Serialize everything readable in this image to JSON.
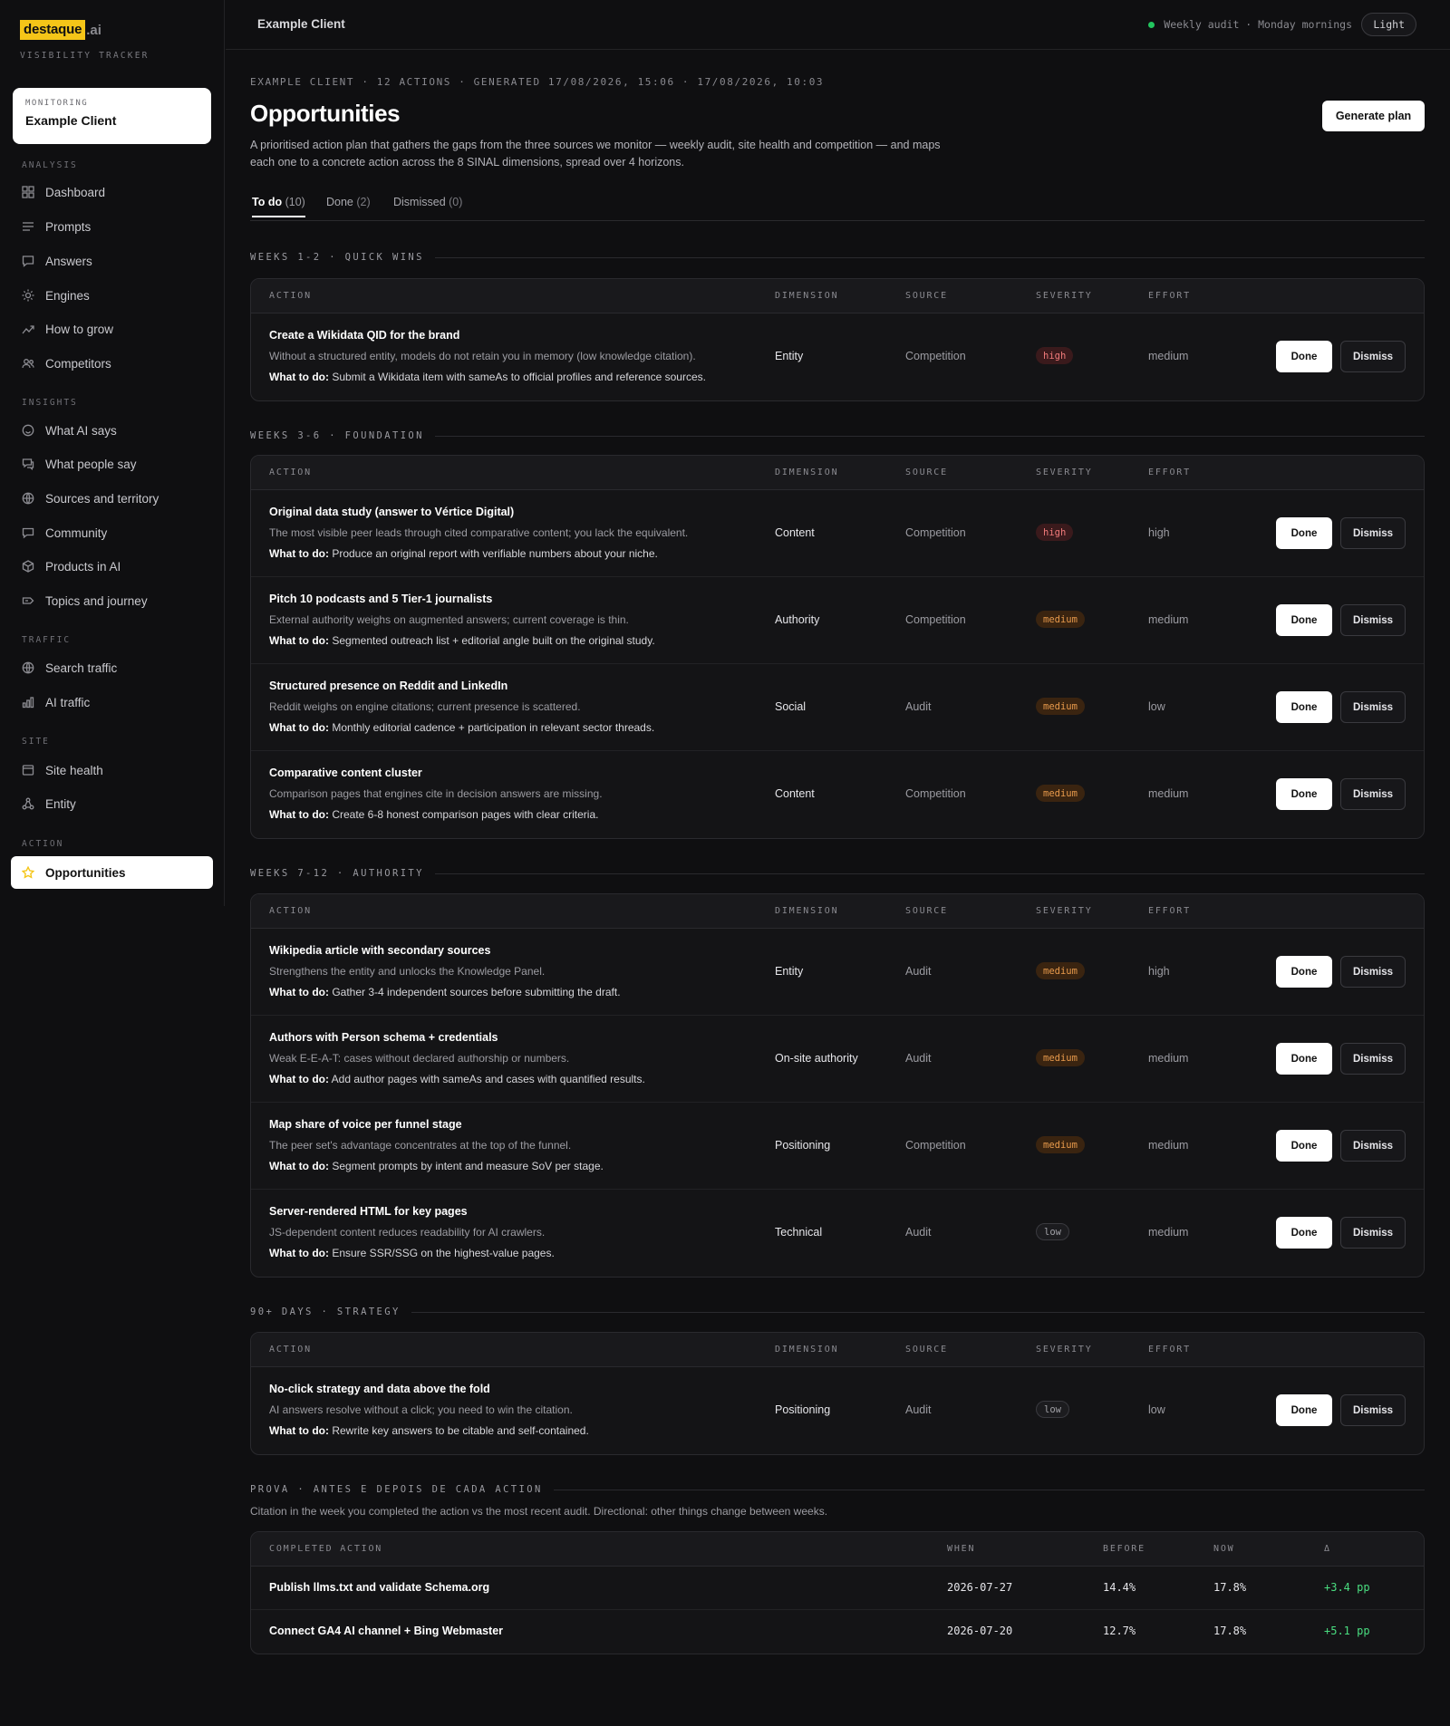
{
  "brand": {
    "logo_main": "destaque",
    "logo_suffix": ".ai",
    "subtitle": "VISIBILITY TRACKER",
    "accent": "#f5c518"
  },
  "monitoring": {
    "label": "MONITORING",
    "client": "Example Client"
  },
  "nav": {
    "sections": [
      {
        "title": "ANALYSIS",
        "items": [
          {
            "label": "Dashboard",
            "icon": "grid-icon"
          },
          {
            "label": "Prompts",
            "icon": "lines-icon"
          },
          {
            "label": "Answers",
            "icon": "chat-icon"
          },
          {
            "label": "Engines",
            "icon": "sun-icon"
          },
          {
            "label": "How to grow",
            "icon": "trend-icon"
          },
          {
            "label": "Competitors",
            "icon": "users-icon"
          }
        ]
      },
      {
        "title": "INSIGHTS",
        "items": [
          {
            "label": "What AI says",
            "icon": "smile-icon"
          },
          {
            "label": "What people say",
            "icon": "message-icon"
          },
          {
            "label": "Sources and territory",
            "icon": "globe-icon"
          },
          {
            "label": "Community",
            "icon": "comment-icon"
          },
          {
            "label": "Products in AI",
            "icon": "box-icon"
          },
          {
            "label": "Topics and journey",
            "icon": "tag-icon"
          }
        ]
      },
      {
        "title": "TRAFFIC",
        "items": [
          {
            "label": "Search traffic",
            "icon": "globe-icon"
          },
          {
            "label": "AI traffic",
            "icon": "bars-icon"
          }
        ]
      },
      {
        "title": "SITE",
        "items": [
          {
            "label": "Site health",
            "icon": "window-icon"
          },
          {
            "label": "Entity",
            "icon": "network-icon"
          }
        ]
      },
      {
        "title": "ACTION",
        "items": [
          {
            "label": "Opportunities",
            "icon": "star-icon",
            "active": true
          }
        ]
      }
    ]
  },
  "topbar": {
    "client": "Example Client",
    "audit_status": "Weekly audit · Monday mornings",
    "theme_toggle": "Light"
  },
  "page": {
    "meta": "EXAMPLE CLIENT · 12 ACTIONS · GENERATED 17/08/2026, 15:06 · 17/08/2026, 10:03",
    "title": "Opportunities",
    "description": "A prioritised action plan that gathers the gaps from the three sources we monitor — weekly audit, site health and competition — and maps each one to a concrete action across the 8 SINAL dimensions, spread over 4 horizons.",
    "generate_button": "Generate plan"
  },
  "tabs": [
    {
      "label": "To do",
      "count": "(10)",
      "active": true
    },
    {
      "label": "Done",
      "count": "(2)"
    },
    {
      "label": "Dismissed",
      "count": "(0)"
    }
  ],
  "columns": {
    "action": "ACTION",
    "dimension": "DIMENSION",
    "source": "SOURCE",
    "severity": "SEVERITY",
    "effort": "EFFORT"
  },
  "todo_label": "What to do:",
  "buttons": {
    "done": "Done",
    "dismiss": "Dismiss"
  },
  "groups": [
    {
      "title": "WEEKS 1-2 · QUICK WINS",
      "rows": [
        {
          "title": "Create a Wikidata QID for the brand",
          "desc": "Without a structured entity, models do not retain you in memory (low knowledge citation).",
          "todo": "Submit a Wikidata item with sameAs to official profiles and reference sources.",
          "dimension": "Entity",
          "source": "Competition",
          "severity": "high",
          "effort": "medium"
        }
      ]
    },
    {
      "title": "WEEKS 3-6 · FOUNDATION",
      "rows": [
        {
          "title": "Original data study (answer to Vértice Digital)",
          "desc": "The most visible peer leads through cited comparative content; you lack the equivalent.",
          "todo": "Produce an original report with verifiable numbers about your niche.",
          "dimension": "Content",
          "source": "Competition",
          "severity": "high",
          "effort": "high"
        },
        {
          "title": "Pitch 10 podcasts and 5 Tier-1 journalists",
          "desc": "External authority weighs on augmented answers; current coverage is thin.",
          "todo": "Segmented outreach list + editorial angle built on the original study.",
          "dimension": "Authority",
          "source": "Competition",
          "severity": "medium",
          "effort": "medium"
        },
        {
          "title": "Structured presence on Reddit and LinkedIn",
          "desc": "Reddit weighs on engine citations; current presence is scattered.",
          "todo": "Monthly editorial cadence + participation in relevant sector threads.",
          "dimension": "Social",
          "source": "Audit",
          "severity": "medium",
          "effort": "low"
        },
        {
          "title": "Comparative content cluster",
          "desc": "Comparison pages that engines cite in decision answers are missing.",
          "todo": "Create 6-8 honest comparison pages with clear criteria.",
          "dimension": "Content",
          "source": "Competition",
          "severity": "medium",
          "effort": "medium"
        }
      ]
    },
    {
      "title": "WEEKS 7-12 · AUTHORITY",
      "rows": [
        {
          "title": "Wikipedia article with secondary sources",
          "desc": "Strengthens the entity and unlocks the Knowledge Panel.",
          "todo": "Gather 3-4 independent sources before submitting the draft.",
          "dimension": "Entity",
          "source": "Audit",
          "severity": "medium",
          "effort": "high"
        },
        {
          "title": "Authors with Person schema + credentials",
          "desc": "Weak E-E-A-T: cases without declared authorship or numbers.",
          "todo": "Add author pages with sameAs and cases with quantified results.",
          "dimension": "On-site authority",
          "source": "Audit",
          "severity": "medium",
          "effort": "medium"
        },
        {
          "title": "Map share of voice per funnel stage",
          "desc": "The peer set's advantage concentrates at the top of the funnel.",
          "todo": "Segment prompts by intent and measure SoV per stage.",
          "dimension": "Positioning",
          "source": "Competition",
          "severity": "medium",
          "effort": "medium"
        },
        {
          "title": "Server-rendered HTML for key pages",
          "desc": "JS-dependent content reduces readability for AI crawlers.",
          "todo": "Ensure SSR/SSG on the highest-value pages.",
          "dimension": "Technical",
          "source": "Audit",
          "severity": "low",
          "effort": "medium"
        }
      ]
    },
    {
      "title": "90+ DAYS · STRATEGY",
      "rows": [
        {
          "title": "No-click strategy and data above the fold",
          "desc": "AI answers resolve without a click; you need to win the citation.",
          "todo": "Rewrite key answers to be citable and self-contained.",
          "dimension": "Positioning",
          "source": "Audit",
          "severity": "low",
          "effort": "low"
        }
      ]
    }
  ],
  "proof": {
    "title": "PROVA · ANTES E DEPOIS DE CADA ACTION",
    "note": "Citation in the week you completed the action vs the most recent audit. Directional: other things change between weeks.",
    "columns": {
      "action": "COMPLETED ACTION",
      "when": "WHEN",
      "before": "BEFORE",
      "now": "NOW",
      "delta": "Δ"
    },
    "rows": [
      {
        "action": "Publish llms.txt and validate Schema.org",
        "when": "2026-07-27",
        "before": "14.4%",
        "now": "17.8%",
        "delta": "+3.4 pp"
      },
      {
        "action": "Connect GA4 AI channel + Bing Webmaster",
        "when": "2026-07-20",
        "before": "12.7%",
        "now": "17.8%",
        "delta": "+5.1 pp"
      }
    ]
  }
}
